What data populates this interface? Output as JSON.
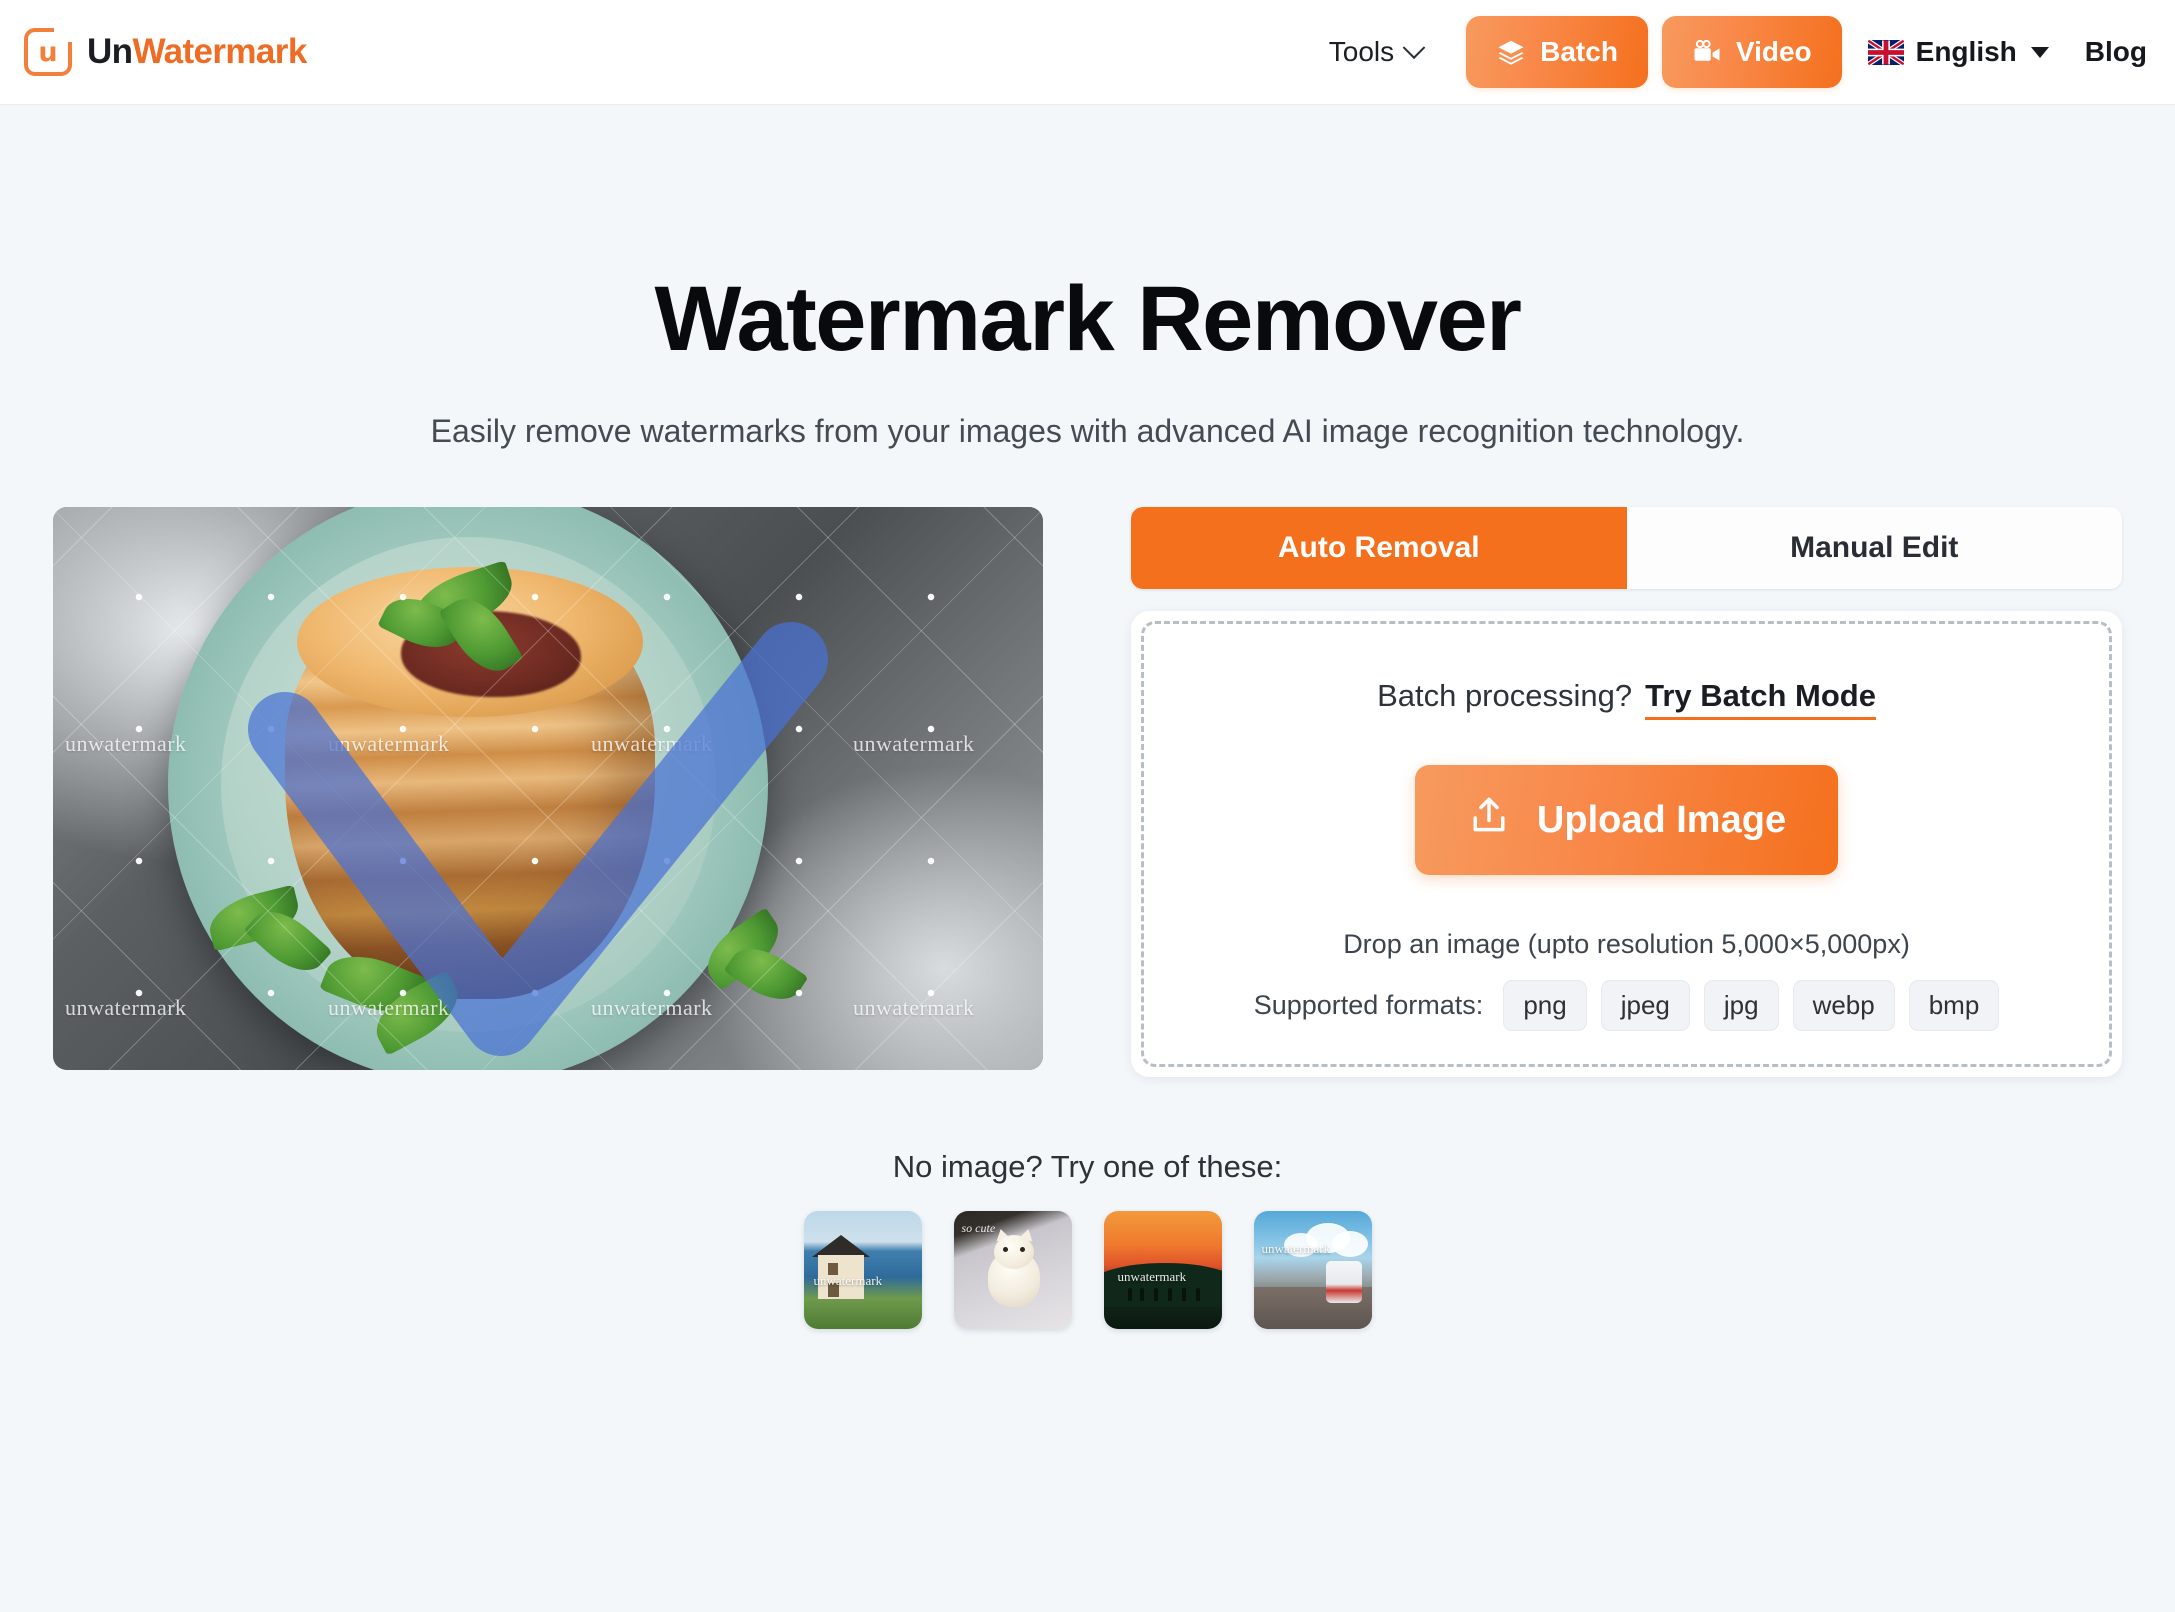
{
  "header": {
    "brand": {
      "part1": "Un",
      "part2": "Watermark",
      "mark_letter": "u",
      "mark_icon": "document-u-logo-icon"
    },
    "tools_label": "Tools",
    "batch_label": "Batch",
    "video_label": "Video",
    "language_label": "English",
    "blog_label": "Blog"
  },
  "hero": {
    "title": "Watermark Remover",
    "subtitle": "Easily remove watermarks from your images with advanced AI image recognition technology."
  },
  "preview": {
    "watermark_text": "unwatermark",
    "alt": "Pancake stack on teal plate with tiled unwatermark watermark and blue brush stroke"
  },
  "panel": {
    "tabs": [
      {
        "label": "Auto Removal",
        "active": true
      },
      {
        "label": "Manual Edit",
        "active": false
      }
    ],
    "batch_prompt": "Batch processing?",
    "batch_link": "Try Batch Mode",
    "upload_label": "Upload Image",
    "drop_hint": "Drop an image (upto resolution 5,000×5,000px)",
    "formats_label": "Supported formats:",
    "formats": [
      "png",
      "jpeg",
      "jpg",
      "webp",
      "bmp"
    ]
  },
  "samples": {
    "title": "No image? Try one of these:",
    "items": [
      {
        "name": "house-by-the-sea",
        "watermark": "unwatermark"
      },
      {
        "name": "white-kitten",
        "watermark": "so cute"
      },
      {
        "name": "sunset-silhouettes",
        "watermark": "unwatermark"
      },
      {
        "name": "bus-on-road",
        "watermark": "unwatermark"
      }
    ]
  },
  "colors": {
    "accent": "#f4701d",
    "accent_light": "#f79a5e",
    "page_bg": "#f3f7fa",
    "brush_blue": "#4a72d4",
    "text_dark": "#15181d"
  }
}
